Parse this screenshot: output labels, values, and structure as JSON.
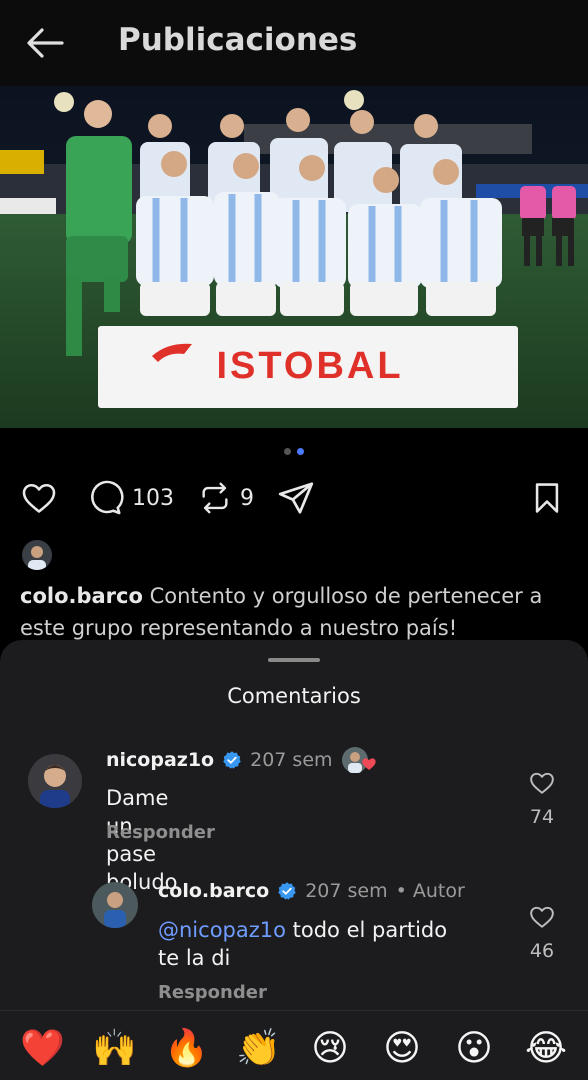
{
  "header": {
    "title": "Publicaciones",
    "back_icon": "arrow-left-icon"
  },
  "post": {
    "banner_text": "ISTOBAL",
    "carousel": {
      "count": 2,
      "active": 2
    },
    "comments_count": "103",
    "reposts_count": "9",
    "caption_user": "colo.barco",
    "caption_text": "Contento y orgulloso de pertenecer a este grupo representando a nuestro país!"
  },
  "comments_sheet": {
    "title": "Comentarios",
    "comments": [
      {
        "user": "nicopaz1o",
        "time": "207 sem",
        "text": "Dame un pase boludo",
        "reply_label": "Responder",
        "likes": "74",
        "liked_by_author": true
      },
      {
        "user": "colo.barco",
        "time": "207 sem",
        "author_tag": "• Autor",
        "mention": "@nicopaz1o",
        "text_line1": " todo el partido",
        "text_line2": "te la di",
        "reply_label": "Responder",
        "likes": "46"
      }
    ]
  },
  "emoji_bar": [
    "❤️",
    "🙌",
    "🔥",
    "👏",
    "😢",
    "😍",
    "😮",
    "😂"
  ],
  "colors": {
    "accent_blue": "#4a7bff",
    "verified": "#3897f0",
    "banner_red": "#e0302a",
    "like_red": "#ed4956"
  }
}
